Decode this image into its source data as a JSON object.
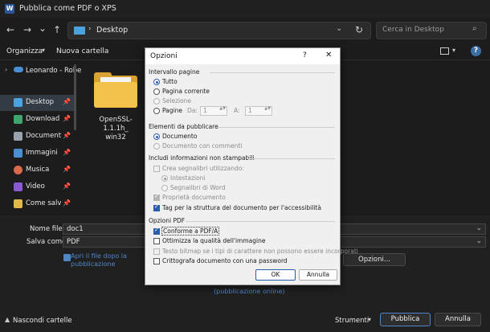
{
  "window": {
    "title": "Pubblica come PDF o XPS",
    "app_icon": "W"
  },
  "nav": {
    "back_icon": "←",
    "forward_icon": "→",
    "recent_icon": "⌄",
    "up_icon": "↑",
    "breadcrumb_sep": "›",
    "location": "Desktop",
    "dropdown_icon": "⌄",
    "refresh_icon": "↻",
    "search_placeholder": "Cerca in Desktop",
    "search_icon": "⌕"
  },
  "toolbar": {
    "organize": "Organizza",
    "organize_chev": "▾",
    "new_folder": "Nuova cartella",
    "view_chev": "▾",
    "help": "?"
  },
  "sidebar": {
    "chev": "›",
    "onedrive": "Leonardo - Robe",
    "items": [
      {
        "label": "Desktop",
        "color": "#4aa3df",
        "pin": "📌"
      },
      {
        "label": "Download",
        "color": "#3fa66e",
        "pin": "📌"
      },
      {
        "label": "Documenti",
        "color": "#9aa3ad",
        "pin": "📌"
      },
      {
        "label": "Immagini",
        "color": "#4a8fd4",
        "pin": "📌"
      },
      {
        "label": "Musica",
        "color": "#d96a4a",
        "pin": "📌"
      },
      {
        "label": "Video",
        "color": "#8a5ad4",
        "pin": "📌"
      },
      {
        "label": "Come salvare",
        "color": "#e0b84a",
        "pin": "📌"
      }
    ]
  },
  "content": {
    "folder_name_line1": "OpenSSL-1.1.1h_",
    "folder_name_line2": "win32"
  },
  "form": {
    "filename_label": "Nome file:",
    "filename_value": "doc1",
    "savetype_label": "Salva come:",
    "savetype_value": "PDF",
    "dd_icon": "⌄",
    "open_after_line1": "Apri il file dopo la",
    "open_after_line2": "pubblicazione",
    "options_button": "Opzioni...",
    "publish_online": "(pubblicazione online)",
    "hide_folders_chev": "▲",
    "hide_folders": "Nascondi cartelle",
    "tools": "Strumenti",
    "tools_chev": "▾",
    "publish": "Pubblica",
    "cancel": "Annulla"
  },
  "dialog": {
    "title": "Opzioni",
    "help": "?",
    "close": "✕",
    "page_range": {
      "heading": "Intervallo pagine",
      "all": "Tutto",
      "current": "Pagina corrente",
      "selection": "Selezione",
      "pages": "Pagine",
      "from_label": "Da:",
      "from_value": "1",
      "to_label": "A:",
      "to_value": "1",
      "spin_icon": "▲▼"
    },
    "publish_what": {
      "heading": "Elementi da pubblicare",
      "document": "Documento",
      "document_with_comments": "Documento con commenti"
    },
    "nonprint": {
      "heading": "Includi informazioni non stampabili",
      "create_bookmarks": "Crea segnalibri utilizzando:",
      "headings": "Intestazioni",
      "word_bookmarks": "Segnalibri di Word",
      "doc_properties": "Proprietà documento",
      "tags": "Tag per la struttura del documento per l'accessibilità"
    },
    "pdf_options": {
      "heading": "Opzioni PDF",
      "pdfa": "Conforme a PDF/A",
      "optimize": "Ottimizza la qualità dell'immagine",
      "bitmap": "Testo bitmap se i tipi di carattere non possono essere incorporati",
      "encrypt": "Crittografa documento con una password"
    },
    "ok": "OK",
    "cancel": "Annulla"
  }
}
